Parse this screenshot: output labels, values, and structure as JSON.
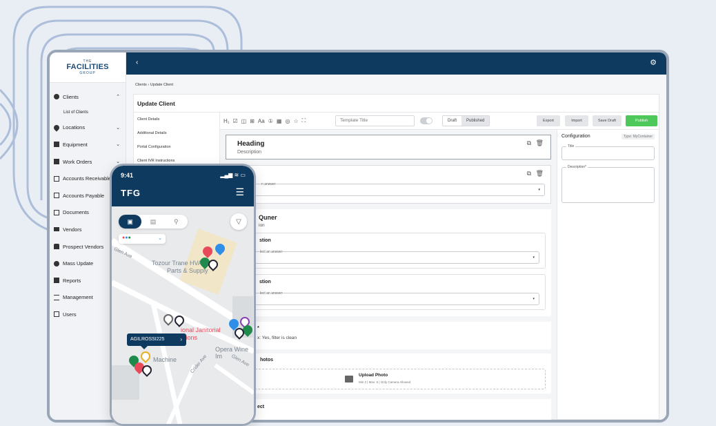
{
  "brand": {
    "line1": "THE",
    "line2": "FACILITIES",
    "line3": "GROUP"
  },
  "sidebar": {
    "items": [
      {
        "label": "Clients",
        "icon": "user-circle-icon",
        "chevron": "^"
      },
      {
        "sub": "List of Clients"
      },
      {
        "label": "Locations",
        "icon": "map-pin-icon",
        "chevron": "v"
      },
      {
        "label": "Equipment",
        "icon": "clipboard-icon",
        "chevron": "v"
      },
      {
        "label": "Work Orders",
        "icon": "grid-icon",
        "chevron": "v"
      },
      {
        "label": "Accounts Receivable",
        "icon": "invoice-icon"
      },
      {
        "label": "Accounts Payable",
        "icon": "invoice-icon"
      },
      {
        "label": "Documents",
        "icon": "document-icon"
      },
      {
        "label": "Vendors",
        "icon": "truck-icon"
      },
      {
        "label": "Prospect Vendors",
        "icon": "car-icon"
      },
      {
        "label": "Mass Update",
        "icon": "clock-icon"
      },
      {
        "label": "Reports",
        "icon": "report-icon"
      },
      {
        "label": "Management",
        "icon": "sliders-icon"
      },
      {
        "label": "Users",
        "icon": "users-icon"
      }
    ]
  },
  "topbar": {
    "back": "‹",
    "settings": "⚙"
  },
  "breadcrumb": "Clients  ›  Update Client",
  "panel": {
    "title": "Update Client"
  },
  "tabs": [
    "Client Details",
    "Additional Details",
    "Portal Configuration",
    "Client IVR Instructions"
  ],
  "toolbar": {
    "tools": [
      "H₁",
      "☑",
      "◫",
      "⊞",
      "Aa",
      "①",
      "▦",
      "◎",
      "☆",
      "⛶"
    ],
    "template_placeholder": "Template Title",
    "draft": "Draft",
    "published": "Published",
    "export": "Export",
    "import": "Import",
    "save_draft": "Save Draft",
    "publish": "Publish"
  },
  "builder": {
    "heading": "Heading",
    "description": "Description",
    "select_placeholder": "n answer",
    "question_title": "Quner",
    "question_desc": "ion",
    "question1": "stion",
    "question2": "stion",
    "select_answer": "lect an answer",
    "q3_title": "*",
    "q3_desc": "x: Yes, filter is clean",
    "photos_title": "hotos",
    "upload_title": "Upload Photo",
    "upload_meta": "Min 2 | Max: 5 | Only Camera Allowed",
    "last_title": "ect"
  },
  "config": {
    "title": "Configuration",
    "type": "Type: MyContainer",
    "title_label": "Title",
    "desc_label": "Description*"
  },
  "phone": {
    "time": "9:41",
    "status": "▂▄▆ ≋ ▭",
    "brand": "TFG",
    "menu": "☰",
    "map_labels": [
      "Glen Ave",
      "Tozour Trane HVAC",
      "Parts & Supply",
      "ional Janitorial",
      "utions",
      "Opera Wine Im",
      "Machine",
      "Crider Ave",
      "Glen Ave"
    ],
    "tooltip": "AGILROSSI225"
  },
  "colors": {
    "navy": "#0f3a5f",
    "green": "#4fc85b",
    "pin_red": "#e84a5a",
    "pin_blue": "#2f8fe8",
    "pin_green": "#1f8a4c",
    "pin_purple": "#8a3fb5",
    "pin_yellow": "#e8b020"
  }
}
